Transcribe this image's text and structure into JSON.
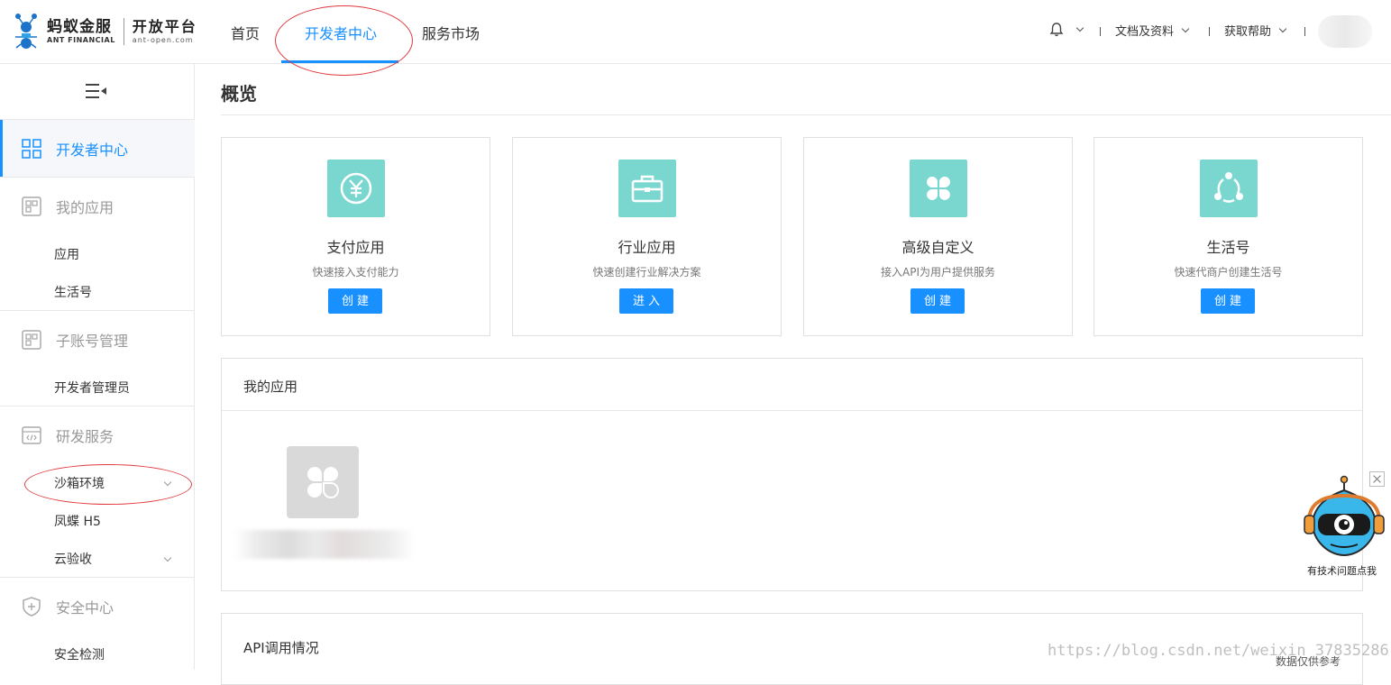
{
  "brand": {
    "name_cn": "蚂蚁金服",
    "name_en": "ANT FINANCIAL",
    "platform_cn": "开放平台",
    "platform_en": "ant-open.com"
  },
  "nav": {
    "items": [
      {
        "label": "首页"
      },
      {
        "label": "开发者中心",
        "active": true
      },
      {
        "label": "服务市场"
      }
    ]
  },
  "header_right": {
    "notification_icon": "bell-icon",
    "docs_label": "文档及资料",
    "help_label": "获取帮助"
  },
  "sidebar": {
    "collapse_icon": "menu-fold-icon",
    "groups": [
      {
        "label": "开发者中心",
        "icon": "grid-icon",
        "active": true,
        "items": []
      },
      {
        "label": "我的应用",
        "icon": "app-icon",
        "items": [
          {
            "label": "应用"
          },
          {
            "label": "生活号"
          }
        ]
      },
      {
        "label": "子账号管理",
        "icon": "app-icon",
        "items": [
          {
            "label": "开发者管理员"
          }
        ]
      },
      {
        "label": "研发服务",
        "icon": "code-window-icon",
        "items": [
          {
            "label": "沙箱环境",
            "expandable": true
          },
          {
            "label": "凤蝶 H5"
          },
          {
            "label": "云验收",
            "expandable": true
          }
        ]
      },
      {
        "label": "安全中心",
        "icon": "shield-icon",
        "items": [
          {
            "label": "安全检测"
          }
        ]
      }
    ]
  },
  "page": {
    "title": "概览"
  },
  "cards": [
    {
      "title": "支付应用",
      "desc": "快速接入支付能力",
      "button": "创建",
      "icon": "yen-icon"
    },
    {
      "title": "行业应用",
      "desc": "快速创建行业解决方案",
      "button": "进入",
      "icon": "briefcase-icon"
    },
    {
      "title": "高级自定义",
      "desc": "接入API为用户提供服务",
      "button": "创建",
      "icon": "clover-icon"
    },
    {
      "title": "生活号",
      "desc": "快速代商户创建生活号",
      "button": "创建",
      "icon": "share-circle-icon"
    }
  ],
  "my_apps": {
    "title": "我的应用",
    "app_icon": "clover-icon"
  },
  "api_usage": {
    "title": "API调用情况",
    "note": "数据仅供参考"
  },
  "watermark": "https://blog.csdn.net/weixin_37835286",
  "assistant": {
    "label": "有技术问题点我",
    "icon": "robot-mascot-icon"
  },
  "colors": {
    "accent": "#1890ff",
    "tile": "#7ad7cf",
    "annotation": "#e0393e"
  }
}
